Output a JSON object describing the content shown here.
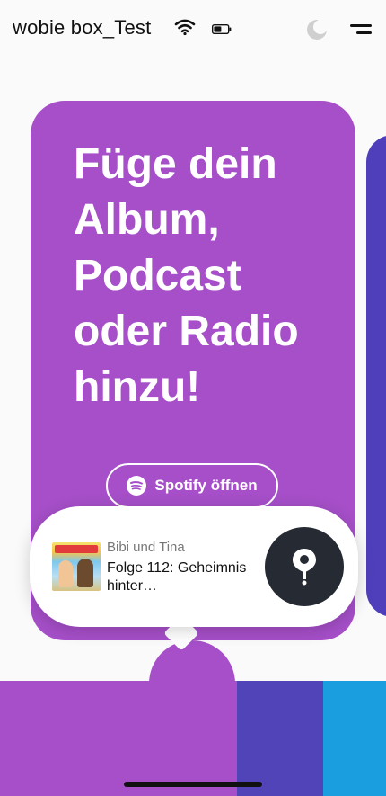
{
  "header": {
    "device_name": "wobie box_Test",
    "wifi_icon": "wifi-icon",
    "battery_icon": "battery-icon",
    "moon_icon": "moon-icon",
    "menu_icon": "menu-icon"
  },
  "card": {
    "title": "Füge dein Album, Podcast oder Radio hinzu!",
    "button_label": "Spotify öffnen",
    "button_icon": "spotify-icon",
    "color": "#a64fc9"
  },
  "now_playing": {
    "artist": "Bibi und Tina",
    "title": "Folge 112: Geheimnis hinter…",
    "location_icon": "location-pin-icon"
  },
  "colors": {
    "purple": "#a64fc9",
    "indigo": "#5143b8",
    "blue": "#1a9ee0",
    "dark_button": "#252a33"
  }
}
